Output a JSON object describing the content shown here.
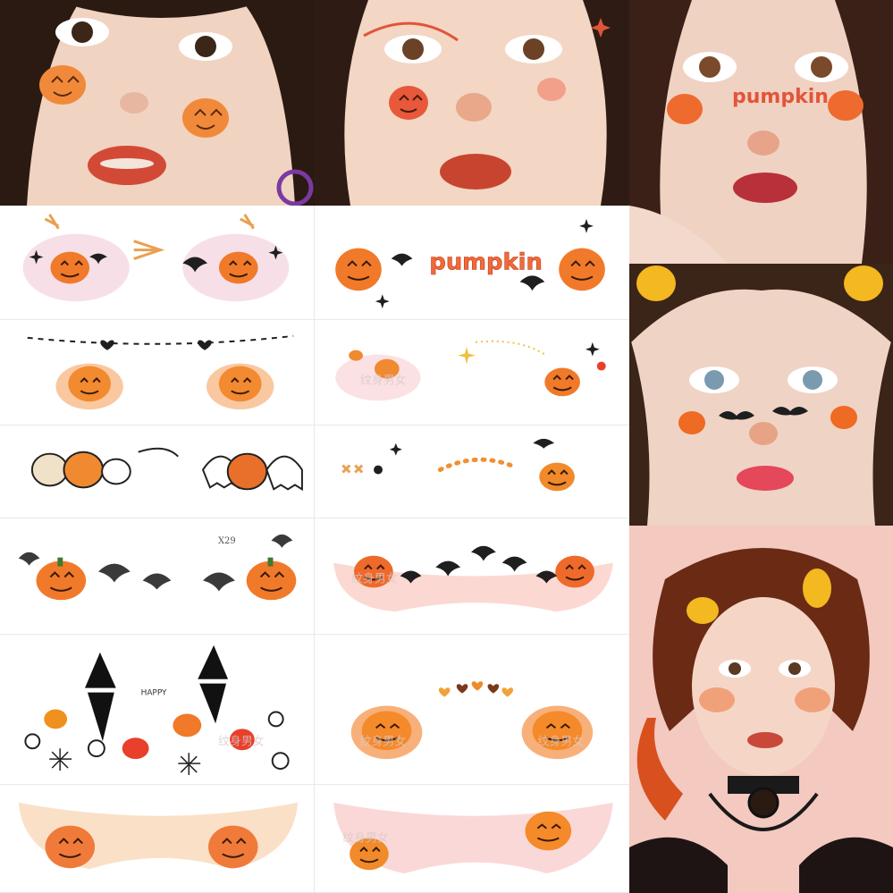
{
  "image": {
    "subject": "Halloween pumpkin face sticker collage",
    "photos": [
      {
        "id": "photo-1",
        "desc": "girl with pumpkin cheek stickers"
      },
      {
        "id": "photo-2",
        "desc": "girl with single pumpkin and stars"
      },
      {
        "id": "photo-3",
        "desc": "girl with pumpkin text banner"
      },
      {
        "id": "photo-4",
        "desc": "girl with bats and pumpkins, pumpkin hair clips"
      },
      {
        "id": "photo-5",
        "desc": "girl with red hair, lace choker, pumpkin hair clips"
      }
    ],
    "sheets": {
      "pumpkin_word": "pumpkin",
      "happy_label": "HAPPY",
      "code_label": "X29",
      "watermark": "纹身男女"
    },
    "colors": {
      "pumpkin": "#f07a2a",
      "pumpkin_dark": "#d45a14",
      "stem": "#3f7a2f",
      "bat": "#1f1f1f",
      "blush": "#f6c1b0",
      "skin": "#f4d4c2",
      "hair": "#3a2418"
    }
  }
}
